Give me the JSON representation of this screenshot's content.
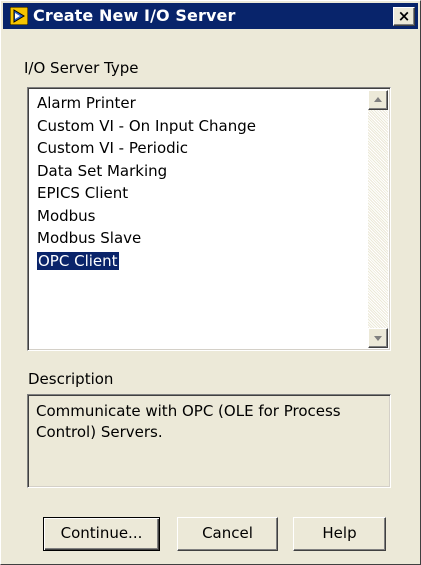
{
  "window": {
    "title": "Create New I/O Server",
    "app_icon": "labview-icon",
    "close_label": "×"
  },
  "server_type": {
    "label": "I/O Server Type",
    "items": [
      "Alarm Printer",
      "Custom VI - On Input Change",
      "Custom VI - Periodic",
      "Data Set Marking",
      "EPICS Client",
      "Modbus",
      "Modbus Slave",
      "OPC Client"
    ],
    "selected": "OPC Client"
  },
  "description": {
    "label": "Description",
    "text": "Communicate with OPC (OLE for Process Control) Servers."
  },
  "buttons": {
    "continue": "Continue...",
    "cancel": "Cancel",
    "help": "Help"
  },
  "colors": {
    "title_bar": "#08246b",
    "selection": "#0a246a",
    "dialog_bg": "#ece9d8"
  }
}
